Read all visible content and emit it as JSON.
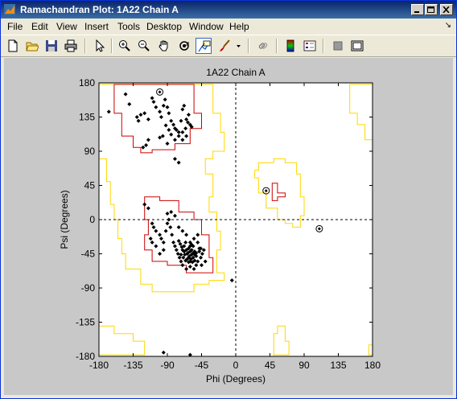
{
  "window": {
    "title": "Ramachandran Plot: 1A22 Chain A"
  },
  "menu": {
    "items": [
      "File",
      "Edit",
      "View",
      "Insert",
      "Tools",
      "Desktop",
      "Window",
      "Help"
    ],
    "arrow": "↘"
  },
  "toolbar": {
    "icons": [
      "new-figure-icon",
      "open-file-icon",
      "save-icon",
      "print-icon",
      "edit-plot-arrow-icon",
      "zoom-in-icon",
      "zoom-out-icon",
      "pan-hand-icon",
      "rotate-3d-icon",
      "data-cursor-icon",
      "brush-icon",
      "brush-dropdown-icon",
      "link-plot-icon",
      "colorbar-icon",
      "legend-icon",
      "hide-plot-tools-icon",
      "show-plot-tools-icon"
    ]
  },
  "chart_data": {
    "type": "scatter",
    "title": "1A22 Chain A",
    "xlabel": "Phi (Degrees)",
    "ylabel": "Psi (Degrees)",
    "xlim": [
      -180,
      180
    ],
    "ylim": [
      -180,
      180
    ],
    "xticks": [
      -180,
      -135,
      -90,
      -45,
      0,
      45,
      90,
      135,
      180
    ],
    "yticks": [
      -180,
      -135,
      -90,
      -45,
      0,
      45,
      90,
      135,
      180
    ],
    "reference_lines": [
      "phi = 0 (dashed)",
      "psi = 0 (dashed)"
    ],
    "region_colors": {
      "core": "#cc0000",
      "allowed": "#ffd700"
    },
    "core_regions": [
      [
        [
          -160,
          178
        ],
        [
          -55,
          178
        ],
        [
          -55,
          140
        ],
        [
          -45,
          140
        ],
        [
          -45,
          120
        ],
        [
          -60,
          120
        ],
        [
          -60,
          100
        ],
        [
          -80,
          100
        ],
        [
          -80,
          92
        ],
        [
          -110,
          92
        ],
        [
          -110,
          88
        ],
        [
          -125,
          88
        ],
        [
          -125,
          95
        ],
        [
          -135,
          95
        ],
        [
          -135,
          110
        ],
        [
          -150,
          110
        ],
        [
          -150,
          140
        ],
        [
          -160,
          140
        ]
      ],
      [
        [
          -120,
          30
        ],
        [
          -100,
          30
        ],
        [
          -100,
          25
        ],
        [
          -75,
          25
        ],
        [
          -75,
          10
        ],
        [
          -55,
          10
        ],
        [
          -55,
          0
        ],
        [
          -45,
          0
        ],
        [
          -45,
          -20
        ],
        [
          -35,
          -20
        ],
        [
          -35,
          -50
        ],
        [
          -30,
          -50
        ],
        [
          -30,
          -70
        ],
        [
          -65,
          -70
        ],
        [
          -65,
          -60
        ],
        [
          -90,
          -60
        ],
        [
          -90,
          -55
        ],
        [
          -110,
          -55
        ],
        [
          -110,
          -40
        ],
        [
          -120,
          -40
        ],
        [
          -120,
          -20
        ],
        [
          -115,
          -20
        ],
        [
          -115,
          0
        ],
        [
          -120,
          0
        ]
      ],
      [
        [
          48,
          48
        ],
        [
          55,
          48
        ],
        [
          55,
          35
        ],
        [
          65,
          35
        ],
        [
          65,
          30
        ],
        [
          55,
          30
        ],
        [
          55,
          25
        ],
        [
          48,
          25
        ]
      ]
    ],
    "allowed_regions": [
      [
        [
          -180,
          178
        ],
        [
          -30,
          178
        ],
        [
          -30,
          140
        ],
        [
          -20,
          140
        ],
        [
          -20,
          115
        ],
        [
          -15,
          115
        ],
        [
          -15,
          90
        ],
        [
          -30,
          90
        ],
        [
          -30,
          80
        ],
        [
          -40,
          80
        ],
        [
          -40,
          60
        ],
        [
          -30,
          60
        ],
        [
          -30,
          30
        ],
        [
          -35,
          30
        ],
        [
          -35,
          10
        ],
        [
          -25,
          10
        ],
        [
          -25,
          -15
        ],
        [
          -20,
          -15
        ],
        [
          -20,
          -40
        ],
        [
          -25,
          -40
        ],
        [
          -25,
          -70
        ],
        [
          -15,
          -70
        ],
        [
          -15,
          -80
        ],
        [
          -35,
          -80
        ],
        [
          -35,
          -85
        ],
        [
          -55,
          -85
        ],
        [
          -55,
          -95
        ],
        [
          -110,
          -95
        ],
        [
          -110,
          -85
        ],
        [
          -125,
          -85
        ],
        [
          -125,
          -65
        ],
        [
          -145,
          -65
        ],
        [
          -145,
          -45
        ],
        [
          -150,
          -45
        ],
        [
          -150,
          -25
        ],
        [
          -155,
          -25
        ],
        [
          -155,
          0
        ],
        [
          -160,
          0
        ],
        [
          -160,
          20
        ],
        [
          -165,
          20
        ],
        [
          -165,
          50
        ],
        [
          -170,
          50
        ],
        [
          -170,
          80
        ],
        [
          -180,
          80
        ]
      ],
      [
        [
          30,
          75
        ],
        [
          50,
          75
        ],
        [
          50,
          80
        ],
        [
          65,
          80
        ],
        [
          65,
          75
        ],
        [
          80,
          75
        ],
        [
          80,
          60
        ],
        [
          85,
          60
        ],
        [
          85,
          30
        ],
        [
          90,
          30
        ],
        [
          90,
          5
        ],
        [
          85,
          5
        ],
        [
          85,
          -10
        ],
        [
          75,
          -10
        ],
        [
          75,
          -5
        ],
        [
          65,
          -5
        ],
        [
          65,
          0
        ],
        [
          55,
          0
        ],
        [
          55,
          15
        ],
        [
          40,
          15
        ],
        [
          40,
          35
        ],
        [
          30,
          35
        ],
        [
          30,
          55
        ],
        [
          25,
          55
        ],
        [
          25,
          65
        ],
        [
          30,
          65
        ]
      ],
      [
        [
          150,
          178
        ],
        [
          180,
          178
        ],
        [
          180,
          105
        ],
        [
          170,
          105
        ],
        [
          170,
          125
        ],
        [
          160,
          125
        ],
        [
          160,
          140
        ],
        [
          150,
          140
        ]
      ],
      [
        [
          -180,
          -140
        ],
        [
          -160,
          -140
        ],
        [
          -160,
          -150
        ],
        [
          -135,
          -150
        ],
        [
          -135,
          -160
        ],
        [
          -120,
          -160
        ],
        [
          -120,
          -178
        ],
        [
          -180,
          -178
        ]
      ],
      [
        [
          55,
          -140
        ],
        [
          65,
          -140
        ],
        [
          65,
          -160
        ],
        [
          70,
          -160
        ],
        [
          70,
          -178
        ],
        [
          50,
          -178
        ],
        [
          50,
          -150
        ],
        [
          55,
          -150
        ]
      ],
      [
        [
          175,
          -165
        ],
        [
          180,
          -165
        ],
        [
          180,
          -178
        ],
        [
          175,
          -178
        ]
      ]
    ],
    "glycine_points": [
      [
        -100,
        168
      ],
      [
        40,
        38
      ],
      [
        110,
        -12
      ]
    ],
    "points": [
      [
        -167,
        142
      ],
      [
        -145,
        165
      ],
      [
        -140,
        152
      ],
      [
        -130,
        135
      ],
      [
        -128,
        130
      ],
      [
        -125,
        138
      ],
      [
        -120,
        140
      ],
      [
        -115,
        132
      ],
      [
        -110,
        160
      ],
      [
        -108,
        155
      ],
      [
        -105,
        148
      ],
      [
        -100,
        142
      ],
      [
        -98,
        135
      ],
      [
        -95,
        150
      ],
      [
        -93,
        158
      ],
      [
        -90,
        148
      ],
      [
        -88,
        140
      ],
      [
        -85,
        130
      ],
      [
        -82,
        125
      ],
      [
        -80,
        120
      ],
      [
        -78,
        118
      ],
      [
        -75,
        115
      ],
      [
        -72,
        130
      ],
      [
        -70,
        145
      ],
      [
        -68,
        150
      ],
      [
        -65,
        132
      ],
      [
        -63,
        128
      ],
      [
        -60,
        125
      ],
      [
        -58,
        122
      ],
      [
        -62,
        138
      ],
      [
        -66,
        120
      ],
      [
        -70,
        115
      ],
      [
        -75,
        110
      ],
      [
        -80,
        105
      ],
      [
        -85,
        112
      ],
      [
        -88,
        118
      ],
      [
        -92,
        124
      ],
      [
        -96,
        110
      ],
      [
        -100,
        108
      ],
      [
        -115,
        105
      ],
      [
        -118,
        98
      ],
      [
        -122,
        95
      ],
      [
        -90,
        100
      ],
      [
        -80,
        80
      ],
      [
        -75,
        75
      ],
      [
        -70,
        105
      ],
      [
        -65,
        110
      ],
      [
        -120,
        20
      ],
      [
        -115,
        15
      ],
      [
        -110,
        -5
      ],
      [
        -108,
        -10
      ],
      [
        -105,
        -15
      ],
      [
        -100,
        -20
      ],
      [
        -98,
        -25
      ],
      [
        -95,
        -30
      ],
      [
        -92,
        -15
      ],
      [
        -90,
        -5
      ],
      [
        -88,
        0
      ],
      [
        -86,
        -10
      ],
      [
        -84,
        -20
      ],
      [
        -82,
        -30
      ],
      [
        -80,
        -35
      ],
      [
        -78,
        -40
      ],
      [
        -76,
        -45
      ],
      [
        -74,
        -50
      ],
      [
        -72,
        -55
      ],
      [
        -70,
        -40
      ],
      [
        -68,
        -35
      ],
      [
        -66,
        -30
      ],
      [
        -64,
        -45
      ],
      [
        -62,
        -50
      ],
      [
        -60,
        -55
      ],
      [
        -58,
        -40
      ],
      [
        -56,
        -35
      ],
      [
        -54,
        -42
      ],
      [
        -52,
        -48
      ],
      [
        -50,
        -30
      ],
      [
        -48,
        -38
      ],
      [
        -46,
        -50
      ],
      [
        -44,
        -45
      ],
      [
        -42,
        -40
      ],
      [
        -62,
        -38
      ],
      [
        -60,
        -42
      ],
      [
        -58,
        -46
      ],
      [
        -56,
        -50
      ],
      [
        -54,
        -54
      ],
      [
        -65,
        -40
      ],
      [
        -63,
        -44
      ],
      [
        -61,
        -48
      ],
      [
        -59,
        -52
      ],
      [
        -57,
        -56
      ],
      [
        -67,
        -46
      ],
      [
        -69,
        -50
      ],
      [
        -71,
        -36
      ],
      [
        -73,
        -32
      ],
      [
        -75,
        -28
      ],
      [
        -60,
        -30
      ],
      [
        -55,
        -25
      ],
      [
        -50,
        -20
      ],
      [
        -65,
        -20
      ],
      [
        -70,
        -15
      ],
      [
        -75,
        -10
      ],
      [
        -80,
        5
      ],
      [
        -85,
        10
      ],
      [
        -90,
        8
      ],
      [
        -95,
        -40
      ],
      [
        -100,
        -45
      ],
      [
        -105,
        -35
      ],
      [
        -110,
        -30
      ],
      [
        -112,
        -25
      ],
      [
        -52,
        -60
      ],
      [
        -55,
        -65
      ],
      [
        -60,
        -62
      ],
      [
        -50,
        -55
      ],
      [
        -45,
        -60
      ],
      [
        -40,
        -55
      ],
      [
        -65,
        -65
      ],
      [
        -70,
        -60
      ],
      [
        -60,
        -35
      ],
      [
        -58,
        -33
      ],
      [
        -64,
        -52
      ],
      [
        -62,
        -56
      ],
      [
        -66,
        -54
      ],
      [
        -68,
        -42
      ],
      [
        -72,
        -46
      ],
      [
        -56,
        -44
      ],
      [
        -54,
        -46
      ],
      [
        -52,
        -44
      ],
      [
        -48,
        -42
      ],
      [
        -46,
        -38
      ],
      [
        -5,
        -80
      ],
      [
        -95,
        -175
      ],
      [
        -60,
        -178
      ]
    ]
  }
}
